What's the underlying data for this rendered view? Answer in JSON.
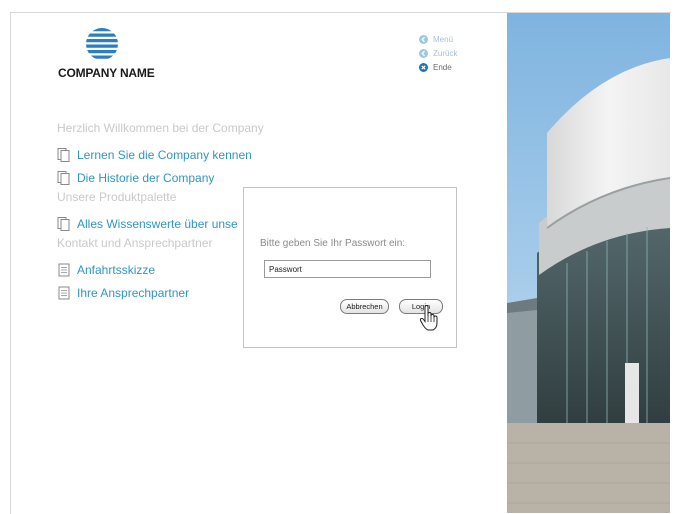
{
  "brand": {
    "company_name": "COMPANY NAME"
  },
  "topnav": [
    {
      "label": "Menü",
      "icon": "arrow-left-icon",
      "style": "light"
    },
    {
      "label": "Zurück",
      "icon": "arrow-left-icon",
      "style": "light"
    },
    {
      "label": "Ende",
      "icon": "close-icon",
      "style": "dark"
    }
  ],
  "menu": {
    "section1": {
      "heading": "Herzlich Willkommen bei der Company",
      "items": [
        "Lernen Sie die Company kennen",
        "Die Historie der Company"
      ]
    },
    "section2": {
      "heading": "Unsere Produktpalette",
      "items": [
        "Alles Wissenswerte über unse"
      ]
    },
    "section3": {
      "heading": "Kontakt und Ansprechpartner",
      "items": [
        "Anfahrtsskizze",
        "Ihre Ansprechpartner"
      ]
    }
  },
  "dialog": {
    "prompt": "Bitte geben Sie Ihr Passwort ein:",
    "password_value": "Passwort",
    "cancel_label": "Abbrechen",
    "login_label": "Login"
  },
  "colors": {
    "accent": "#2f95c8",
    "muted": "#c9c9c9",
    "nav_dark": "#1f73b7"
  }
}
